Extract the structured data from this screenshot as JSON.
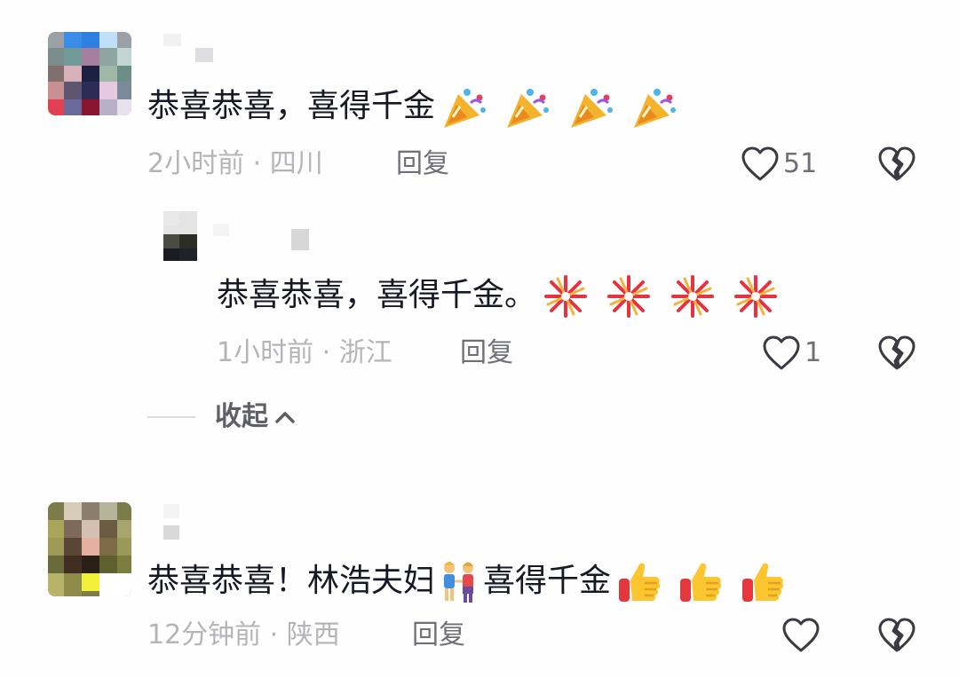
{
  "comments": [
    {
      "text": "恭喜恭喜，喜得千金",
      "emojis": [
        "party-popper",
        "party-popper",
        "party-popper",
        "party-popper"
      ],
      "meta": "2小时前 · 四川",
      "reply_label": "回复",
      "like_count": "51",
      "replies": [
        {
          "text": "恭喜恭喜，喜得千金。",
          "emojis": [
            "fireworks",
            "fireworks",
            "fireworks",
            "fireworks"
          ],
          "meta": "1小时前 · 浙江",
          "reply_label": "回复",
          "like_count": "1"
        }
      ],
      "collapse_label": "收起"
    },
    {
      "text_before": "恭喜恭喜！林浩夫妇",
      "inline_emoji": "couple-holding-hands",
      "text_after": "喜得千金",
      "emojis": [
        "thumbs-up",
        "thumbs-up",
        "thumbs-up"
      ],
      "meta": "12分钟前 · 陕西",
      "reply_label": "回复",
      "like_count": ""
    }
  ],
  "colors": {
    "text": "#161823",
    "meta": "#b4b5b9",
    "action": "#6f7077",
    "background": "#fefefe"
  }
}
